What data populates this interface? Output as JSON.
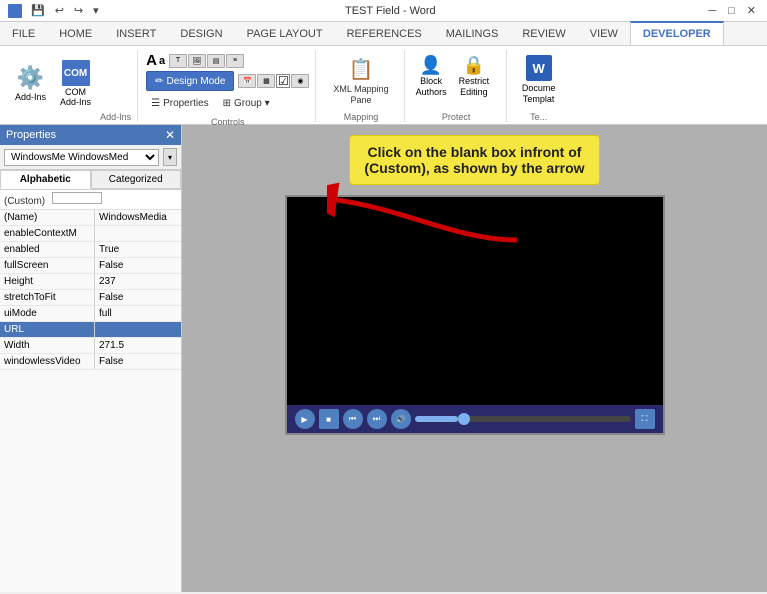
{
  "titlebar": {
    "title": "TEST Field - Word",
    "quickaccess": [
      "save",
      "undo",
      "redo",
      "customize"
    ]
  },
  "ribbon": {
    "tabs": [
      "FILE",
      "HOME",
      "INSERT",
      "DESIGN",
      "PAGE LAYOUT",
      "REFERENCES",
      "MAILINGS",
      "REVIEW",
      "VIEW",
      "DEVELOPER"
    ],
    "active_tab": "DEVELOPER",
    "groups": {
      "addins": {
        "label": "Add-Ins",
        "add_ins_label": "Add-Ins",
        "com_label": "COM\nAdd-Ins"
      },
      "controls": {
        "label": "Controls",
        "design_mode": "Design Mode",
        "properties": "Properties",
        "group": "Group ▾"
      },
      "mapping": {
        "label": "Mapping",
        "xml_mapping_pane": "XML Mapping\nPane"
      },
      "protect": {
        "label": "Protect",
        "block_authors": "Block\nAuthors",
        "restrict_editing": "Restrict\nEditing"
      },
      "templates": {
        "label": "Te...",
        "document_template": "Docume\nTempla..."
      }
    }
  },
  "properties_panel": {
    "title": "Properties",
    "object_name": "WindowsMe WindowsMed",
    "tabs": [
      "Alphabetic",
      "Categorized"
    ],
    "active_tab": "Alphabetic",
    "selected_category": "(Custom)",
    "rows": [
      {
        "key": "(Name)",
        "value": "WindowsMedia"
      },
      {
        "key": "enableContextM",
        "value": ""
      },
      {
        "key": "enabled",
        "value": "True"
      },
      {
        "key": "fullScreen",
        "value": "False"
      },
      {
        "key": "Height",
        "value": "237"
      },
      {
        "key": "stretchToFit",
        "value": "False"
      },
      {
        "key": "uiMode",
        "value": "full"
      },
      {
        "key": "URL",
        "value": "",
        "selected": true
      },
      {
        "key": "Width",
        "value": "271.5"
      },
      {
        "key": "windowlessVideo",
        "value": "False"
      }
    ]
  },
  "annotation": {
    "text": "Click on the blank box infront of\n(Custom), as shown by the arrow"
  },
  "video": {
    "controls_visible": true
  }
}
